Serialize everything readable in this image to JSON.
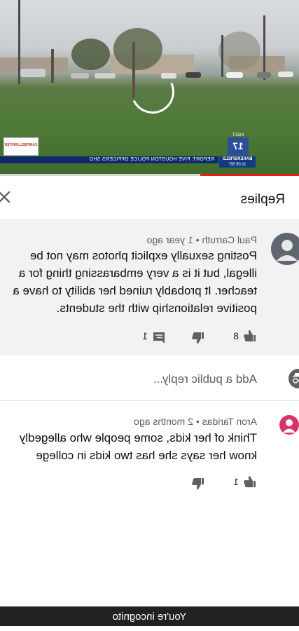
{
  "video": {
    "chyron_text": "REPORT: FIVE HOUSTON POLICE OFFICERS SHO",
    "station_call": "KGET",
    "station_number": "17",
    "station_city": "BAKERSFIELD",
    "station_time": "11:05",
    "station_temp": "55°",
    "sponsor_text": "CAMPBELLWRITER",
    "progress_fraction": 0.33,
    "colors": {
      "chyron": "#0d2a6b",
      "progress": "#e62117"
    }
  },
  "replies_panel": {
    "title": "Replies",
    "close_icon": "close-icon"
  },
  "parent_comment": {
    "author_line": "Paul Carruth • 1 year ago",
    "lines": [
      "Posting sexually explicit photos may not be",
      "illegal, but it is a very embarassing thing for a",
      "teacher.  It probably ruined her ability to have a",
      "positive relationship with the students."
    ],
    "likes": "8",
    "replies": "1",
    "icons": [
      "thumbs-up-icon",
      "thumbs-down-icon",
      "comment-icon"
    ]
  },
  "reply_box": {
    "placeholder": "Add a public reply...",
    "icon": "incognito-avatar-icon"
  },
  "reply": {
    "author_line": "Aron Taridas • 2 months ago",
    "lines": [
      "Think of her kids, some people who allegedly",
      "know her says she has two kids in college"
    ],
    "likes": "1",
    "avatar_color": "#d6336c"
  },
  "footer": {
    "incognito_text": "You're incognito"
  }
}
